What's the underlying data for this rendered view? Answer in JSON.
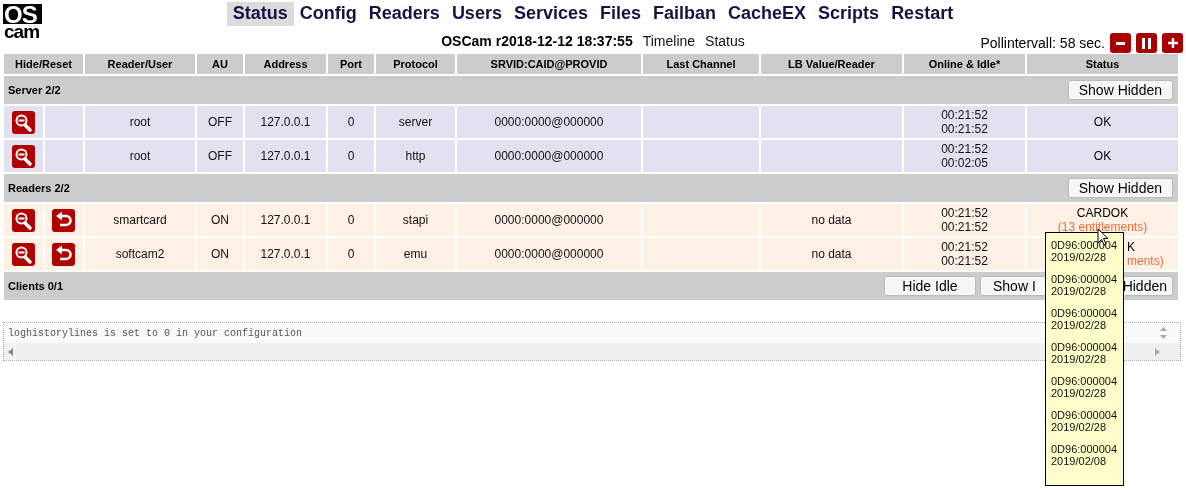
{
  "logo": {
    "top": "OS",
    "bottom": "cam"
  },
  "nav": [
    {
      "label": "Status",
      "selected": true
    },
    {
      "label": "Config",
      "selected": false
    },
    {
      "label": "Readers",
      "selected": false
    },
    {
      "label": "Users",
      "selected": false
    },
    {
      "label": "Services",
      "selected": false
    },
    {
      "label": "Files",
      "selected": false
    },
    {
      "label": "Failban",
      "selected": false
    },
    {
      "label": "CacheEX",
      "selected": false
    },
    {
      "label": "Scripts",
      "selected": false
    },
    {
      "label": "Restart",
      "selected": false
    }
  ],
  "version": "OSCam r2018-12-12 18:37:55",
  "links": [
    "Timeline",
    "Status"
  ],
  "poll": {
    "label": "Pollintervall: 58 sec."
  },
  "columns": [
    "Hide/Reset",
    "Reader/User",
    "AU",
    "Address",
    "Port",
    "Protocol",
    "SRVID:CAID@PROVID",
    "Last Channel",
    "LB Value/Reader",
    "Online & Idle*",
    "Status"
  ],
  "groups": [
    {
      "title": "Server 2/2",
      "kind": "server",
      "buttons": [
        "Show Hidden"
      ],
      "rows": [
        {
          "reset": false,
          "user": "root",
          "au": "OFF",
          "address": "127.0.0.1",
          "port": "0",
          "protocol": "server",
          "srvid": "0000:0000@000000",
          "lb": "",
          "online": "00:21:52",
          "idle": "00:21:52",
          "status": "OK"
        },
        {
          "reset": false,
          "user": "root",
          "au": "OFF",
          "address": "127.0.0.1",
          "port": "0",
          "protocol": "http",
          "srvid": "0000:0000@000000",
          "lb": "",
          "online": "00:21:52",
          "idle": "00:02:05",
          "status": "OK"
        }
      ]
    },
    {
      "title": "Readers 2/2",
      "kind": "reader",
      "buttons": [
        "Show Hidden"
      ],
      "rows": [
        {
          "reset": true,
          "user": "smartcard",
          "au": "ON",
          "address": "127.0.0.1",
          "port": "0",
          "protocol": "stapi",
          "srvid": "0000:0000@000000",
          "lb": "no data",
          "online": "00:21:52",
          "idle": "00:21:52",
          "status": "CARDOK",
          "note": "(13 entitlements)",
          "tooltip": [
            {
              "id": "0D96:000004",
              "date": "2019/02/28"
            },
            {
              "id": "0D96:000004",
              "date": "2019/02/28"
            },
            {
              "id": "0D96:000004",
              "date": "2019/02/28"
            },
            {
              "id": "0D96:000004",
              "date": "2019/02/28"
            },
            {
              "id": "0D96:000004",
              "date": "2019/02/28"
            },
            {
              "id": "0D96:000004",
              "date": "2019/02/28"
            },
            {
              "id": "0D96:000004",
              "date": "2019/02/08"
            }
          ]
        },
        {
          "reset": true,
          "user": "softcam2",
          "au": "ON",
          "address": "127.0.0.1",
          "port": "0",
          "protocol": "emu",
          "srvid": "0000:0000@000000",
          "lb": "no data",
          "online": "00:21:52",
          "idle": "00:21:52",
          "status": "K",
          "note": "ments)"
        }
      ]
    },
    {
      "title": "Clients 0/1",
      "buttons": [
        "Hide Idle",
        "Show I",
        "Hidden"
      ]
    }
  ],
  "log": {
    "text": "loghistorylines is set to 0 in your configuration"
  }
}
